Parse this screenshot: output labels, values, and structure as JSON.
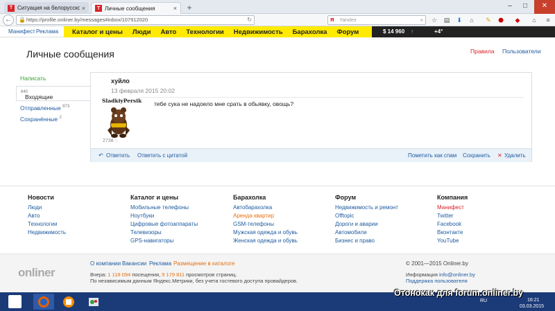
{
  "browser": {
    "tabs": [
      {
        "title": "Ситуация на белорусско...",
        "active": false
      },
      {
        "title": "Личные сообщения",
        "active": true
      }
    ],
    "url": "https://profile.onliner.by/messages#inbox/107912020",
    "search_placeholder": "Yandex",
    "icons": [
      "back-icon",
      "reload-icon",
      "bookmark-star-icon",
      "library-icon",
      "download-icon",
      "home-icon",
      "pocket-icon",
      "menu-icon"
    ]
  },
  "site_menu": {
    "left_links": [
      "Манифест",
      "Реклама"
    ],
    "items": [
      "Каталог и цены",
      "Люди",
      "Авто",
      "Технологии",
      "Недвижимость",
      "Барахолка",
      "Форум"
    ],
    "currency": "$ 14 960",
    "weather": "+4°"
  },
  "page": {
    "title": "Личные сообщения",
    "rules_link": "Правила",
    "users_link": "Пользователи"
  },
  "sidebar": {
    "write": "Написать",
    "inbox": {
      "label": "Входящие",
      "count": "840"
    },
    "sent": {
      "label": "Отправленные",
      "count": "973"
    },
    "saved": {
      "label": "Сохранённые",
      "count": "2"
    }
  },
  "message": {
    "author": "хуйло",
    "date": "13 февраля 2015  20:02",
    "sender_name": "SladkiyPersik",
    "sender_posts": "2738",
    "text": "тебе сука не надоело мне срать в обьявку, овощь?",
    "actions": {
      "reply": "Ответить",
      "quote": "Ответить с цитатой",
      "spam": "Пометить как спам",
      "save": "Сохранить",
      "delete": "Удалить"
    }
  },
  "footer": {
    "columns": [
      {
        "heading": "Новости",
        "items": [
          "Люди",
          "Авто",
          "Технологии",
          "Недвижимость"
        ]
      },
      {
        "heading": "Каталог и цены",
        "items": [
          "Мобильные телефоны",
          "Ноутбуки",
          "Цифровые фотоаппараты",
          "Телевизоры",
          "GPS-навигаторы"
        ]
      },
      {
        "heading": "Барахолка",
        "items": [
          "Автобарахолка",
          "Аренда квартир",
          "GSM-телефоны",
          "Мужская одежда и обувь",
          "Женская одежда и обувь"
        ]
      },
      {
        "heading": "Форум",
        "items": [
          "Недвижимость и ремонт",
          "Offtopic",
          "Дороги и аварии",
          "Автомобили",
          "Бизнес и право"
        ]
      },
      {
        "heading": "Компания",
        "items": [
          "Манифест",
          "Twitter",
          "Facebook",
          "Вконтакте",
          "YouTube"
        ]
      }
    ],
    "logo": "onliner",
    "links": [
      "О компании",
      "Вакансии",
      "Реклама",
      "Размещение в каталоге"
    ],
    "stats": {
      "prefix": "Вчера:",
      "visits": "1 118 094",
      "visits_label": "посещения,",
      "views": "9 179 811",
      "views_label": "просмотров страниц."
    },
    "note": "По независимым данным Яндекс.Метрики, без учета гостевого доступа провайдеров.",
    "copyright": "© 2001—2015 Onliner.by",
    "info_prefix": "Информация",
    "info_email": "info@onliner.by",
    "support": "Поддержка пользователя"
  },
  "taskbar": {
    "watermark": "Отонокак для forum.onliner.by",
    "lang": "RU",
    "time": "16:21",
    "date": "03.03.2015"
  }
}
